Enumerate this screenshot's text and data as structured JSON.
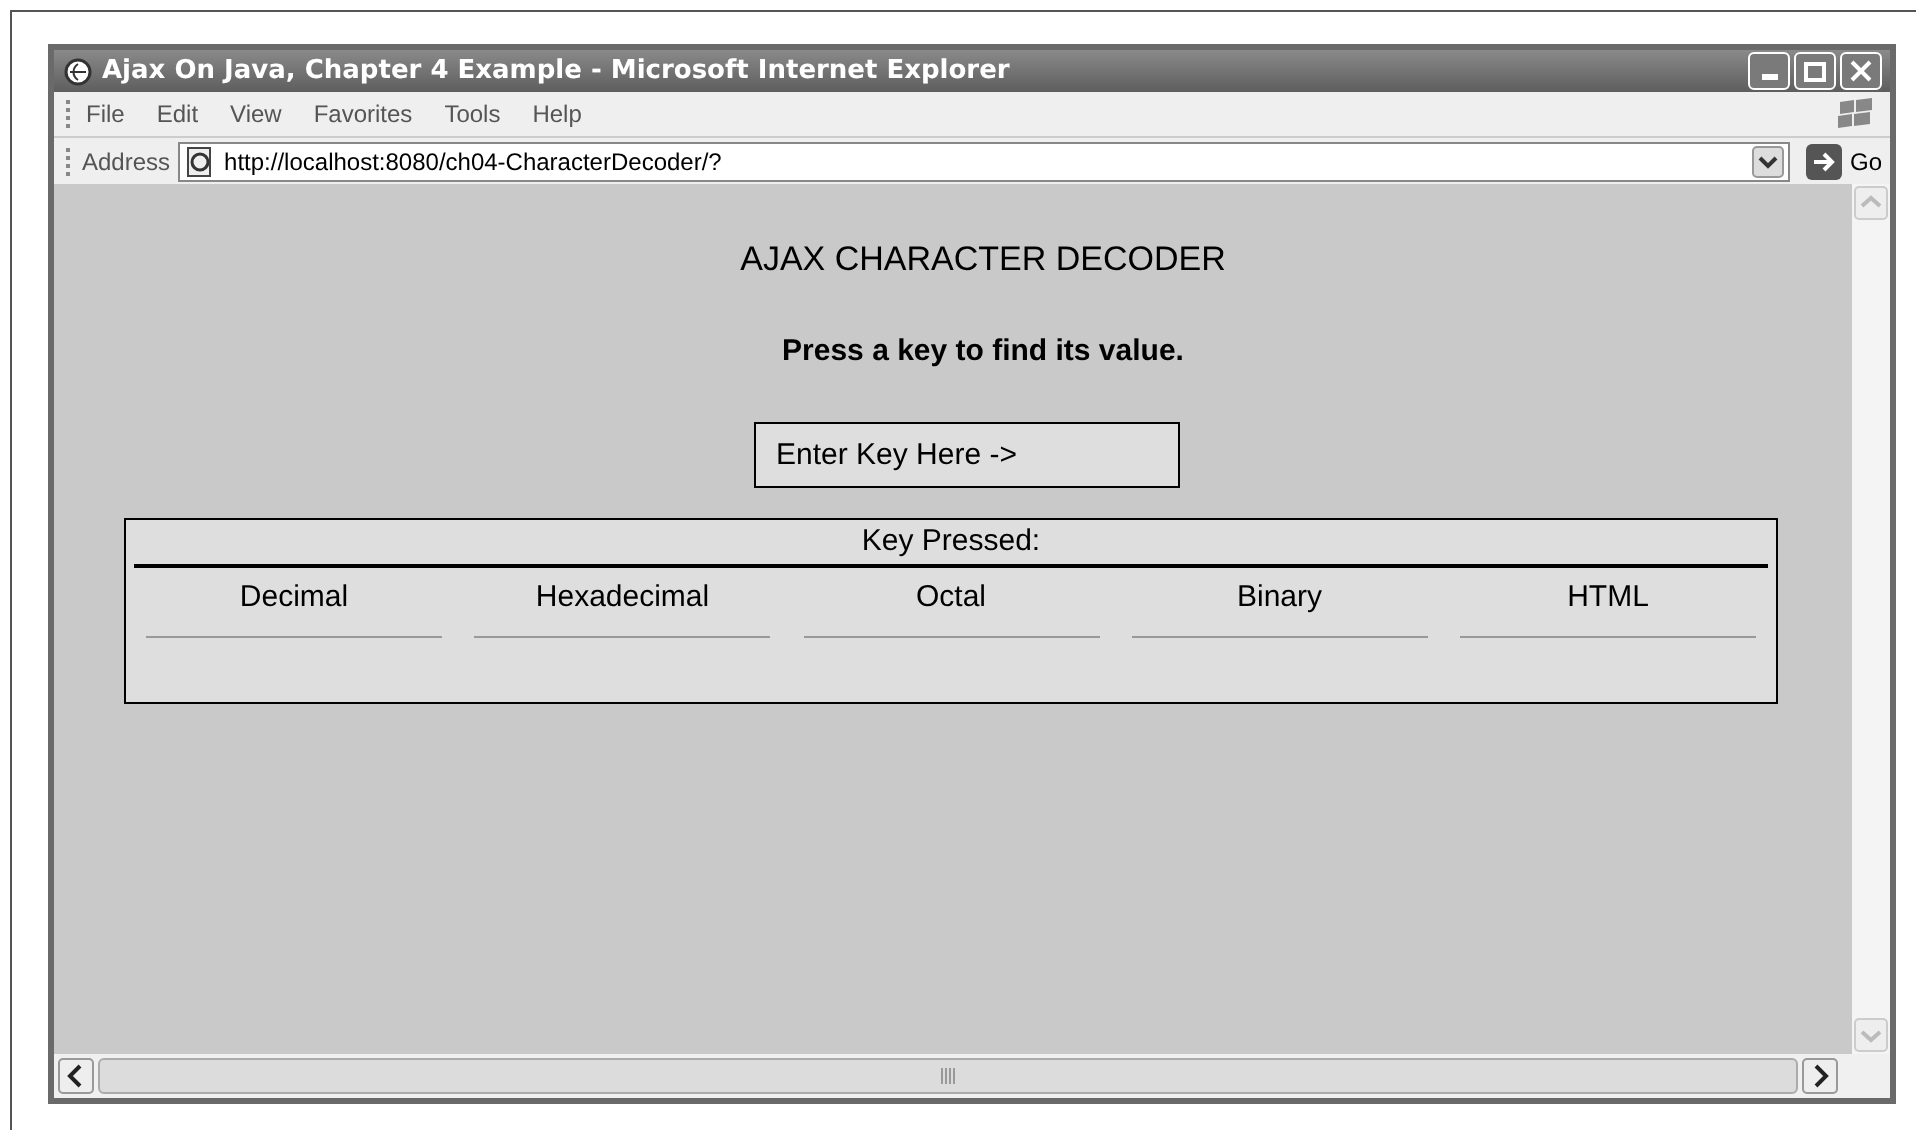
{
  "window": {
    "title": "Ajax On Java, Chapter 4 Example - Microsoft Internet Explorer"
  },
  "menu": [
    "File",
    "Edit",
    "View",
    "Favorites",
    "Tools",
    "Help"
  ],
  "address_bar": {
    "label": "Address",
    "url": "http://localhost:8080/ch04-CharacterDecoder/?",
    "go": "Go"
  },
  "page": {
    "heading": "AJAX CHARACTER DECODER",
    "instruction": "Press a key to find its value.",
    "key_field": {
      "value": "Enter Key Here ->"
    },
    "table": {
      "caption": "Key Pressed:",
      "columns": [
        "Decimal",
        "Hexadecimal",
        "Octal",
        "Binary",
        "HTML"
      ]
    }
  }
}
